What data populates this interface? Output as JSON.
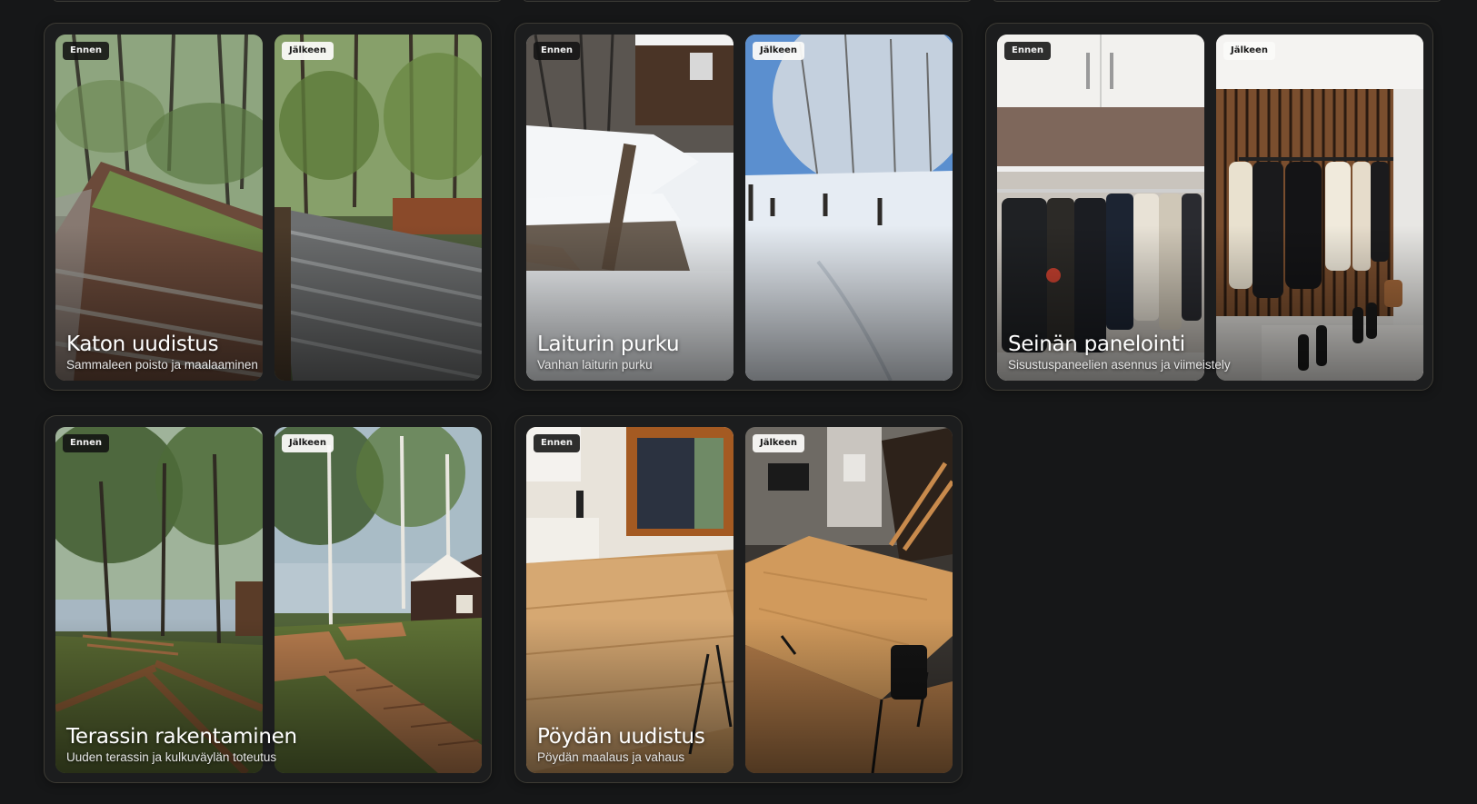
{
  "labels": {
    "before": "Ennen",
    "after": "Jälkeen"
  },
  "projects": [
    {
      "title": "Katon uudistus",
      "subtitle": "Sammaleen poisto ja maalaaminen"
    },
    {
      "title": "Laiturin purku",
      "subtitle": "Vanhan laiturin purku"
    },
    {
      "title": "Seinän panelointi",
      "subtitle": "Sisustuspaneelien asennus ja viimeistely"
    },
    {
      "title": "Terassin rakentaminen",
      "subtitle": "Uuden terassin ja kulkuväylän toteutus"
    },
    {
      "title": "Pöydän uudistus",
      "subtitle": "Pöydän maalaus ja vahaus"
    }
  ],
  "colors": {
    "background": "#161718",
    "card": "#1c1d1e",
    "card_border": "#3d3b34"
  }
}
